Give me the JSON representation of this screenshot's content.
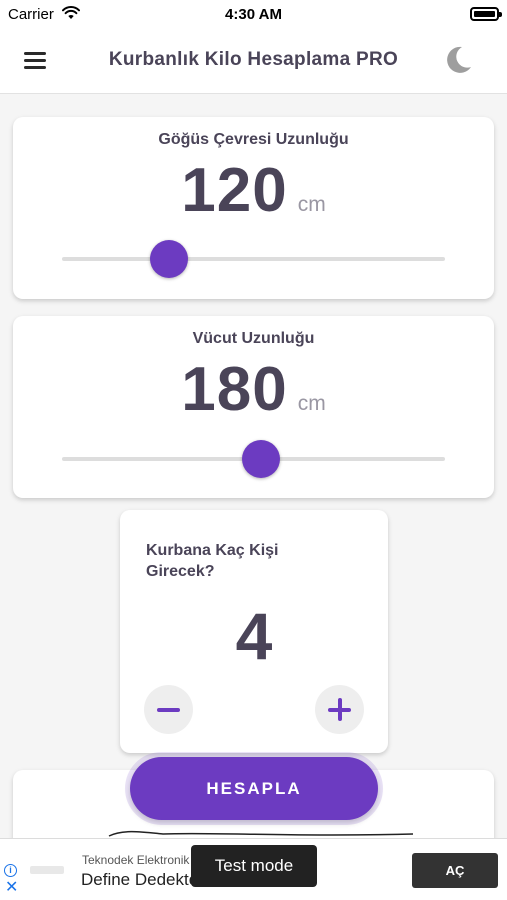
{
  "status_bar": {
    "carrier": "Carrier",
    "time": "4:30 AM"
  },
  "header": {
    "title": "Kurbanlık Kilo Hesaplama PRO",
    "menu_icon": "hamburger-menu-icon",
    "theme_icon": "moon-icon"
  },
  "chest": {
    "label": "Göğüs Çevresi Uzunluğu",
    "value": "120",
    "unit": "cm",
    "slider_fraction": 0.28
  },
  "body_length": {
    "label": "Vücut Uzunluğu",
    "value": "180",
    "unit": "cm",
    "slider_fraction": 0.52
  },
  "people": {
    "label": "Kurbana Kaç Kişi Girecek?",
    "value": "4",
    "minus_icon": "minus-icon",
    "plus_icon": "plus-icon"
  },
  "calculate_button": {
    "label": "HESAPLA"
  },
  "ad": {
    "sponsor": "Teknodek Elektronik",
    "headline": "Define Dedektörü",
    "test_mode": "Test mode",
    "cta": "AÇ"
  },
  "colors": {
    "accent": "#6c3bc1",
    "text": "#4a4458",
    "unit": "#9a97a3",
    "background": "#f5f5f5"
  }
}
